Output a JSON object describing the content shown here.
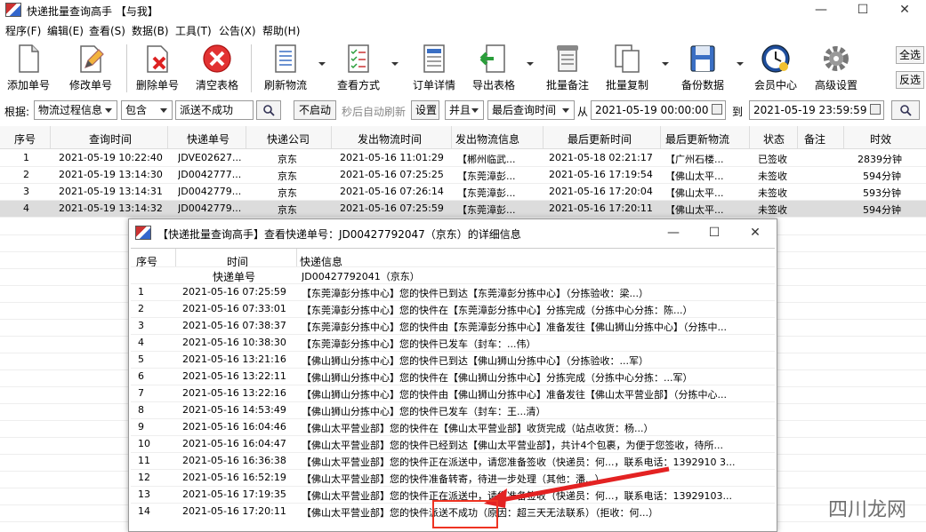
{
  "window": {
    "title": "快递批量查询高手 【与我】"
  },
  "menu": [
    "程序(F)",
    "编辑(E)",
    "查看(S)",
    "数据(B)",
    "工具(T)",
    "公告(X)",
    "帮助(H)"
  ],
  "toolbar": [
    {
      "label": "添加单号",
      "icon": "document-icon"
    },
    {
      "label": "修改单号",
      "icon": "pencil-icon"
    },
    {
      "label": "删除单号",
      "icon": "delete-icon"
    },
    {
      "label": "清空表格",
      "icon": "clear-icon"
    },
    {
      "label": "刷新物流",
      "icon": "refresh-list-icon"
    },
    {
      "label": "查看方式",
      "icon": "checklist-icon"
    },
    {
      "label": "订单详情",
      "icon": "order-detail-icon"
    },
    {
      "label": "导出表格",
      "icon": "export-icon"
    },
    {
      "label": "批量备注",
      "icon": "note-icon"
    },
    {
      "label": "批量复制",
      "icon": "copy-icon"
    },
    {
      "label": "备份数据",
      "icon": "floppy-icon"
    },
    {
      "label": "会员中心",
      "icon": "clock-icon"
    },
    {
      "label": "高级设置",
      "icon": "gear-icon"
    }
  ],
  "side_buttons": [
    "全选",
    "反选"
  ],
  "filter": {
    "label": "根据:",
    "field": "物流过程信息",
    "op": "包含",
    "keyword": "派送不成功",
    "no_start": "不启动",
    "auto_refresh": "秒后自动刷新",
    "settings": "设置",
    "join": "并且",
    "time_field": "最后查询时间",
    "from_label": "从",
    "from": "2021-05-19 00:00:00",
    "to_label": "到",
    "to": "2021-05-19 23:59:59"
  },
  "grid": {
    "headers": [
      "序号",
      "查询时间",
      "快递单号",
      "快递公司",
      "发出物流时间",
      "发出物流信息",
      "最后更新时间",
      "最后更新物流",
      "状态",
      "备注",
      "时效"
    ],
    "rows": [
      [
        "1",
        "2021-05-19 10:22:40",
        "JDVE02627...",
        "京东",
        "2021-05-16 11:01:29",
        "【郴州临武...",
        "2021-05-18 02:21:17",
        "【广州石楼...",
        "已签收",
        "",
        "2839分钟"
      ],
      [
        "2",
        "2021-05-19 13:14:30",
        "JD0042777...",
        "京东",
        "2021-05-16 07:25:25",
        "【东莞漳彭...",
        "2021-05-16 17:19:54",
        "【佛山太平...",
        "未签收",
        "",
        "594分钟"
      ],
      [
        "3",
        "2021-05-19 13:14:31",
        "JD0042779...",
        "京东",
        "2021-05-16 07:26:14",
        "【东莞漳彭...",
        "2021-05-16 17:20:04",
        "【佛山太平...",
        "未签收",
        "",
        "593分钟"
      ],
      [
        "4",
        "2021-05-19 13:14:32",
        "JD0042779...",
        "京东",
        "2021-05-16 07:25:59",
        "【东莞漳彭...",
        "2021-05-16 17:20:11",
        "【佛山太平...",
        "未签收",
        "",
        "594分钟"
      ]
    ]
  },
  "dialog": {
    "title": "【快递批量查询高手】查看快递单号：JD00427792047（京东）的详细信息",
    "headers": [
      "序号",
      "时间",
      "快递信息"
    ],
    "waybill_label": "快递单号",
    "waybill_value": "JD00427792041（京东）",
    "rows": [
      [
        "1",
        "2021-05-16 07:25:59",
        "【东莞漳彭分拣中心】您的快件已到达【东莞漳彭分拣中心】（分拣验收：梁...）"
      ],
      [
        "2",
        "2021-05-16 07:33:01",
        "【东莞漳彭分拣中心】您的快件在【东莞漳彭分拣中心】分拣完成（分拣中心分拣：陈...）"
      ],
      [
        "3",
        "2021-05-16 07:38:37",
        "【东莞漳彭分拣中心】您的快件由【东莞漳彭分拣中心】准备发往【佛山狮山分拣中心】（分拣中..."
      ],
      [
        "4",
        "2021-05-16 10:38:30",
        "【东莞漳彭分拣中心】您的快件已发车（封车：...伟）"
      ],
      [
        "5",
        "2021-05-16 13:21:16",
        "【佛山狮山分拣中心】您的快件已到达【佛山狮山分拣中心】（分拣验收：...军）"
      ],
      [
        "6",
        "2021-05-16 13:22:11",
        "【佛山狮山分拣中心】您的快件在【佛山狮山分拣中心】分拣完成（分拣中心分拣：...军）"
      ],
      [
        "7",
        "2021-05-16 13:22:16",
        "【佛山狮山分拣中心】您的快件由【佛山狮山分拣中心】准备发往【佛山太平营业部】（分拣中心..."
      ],
      [
        "8",
        "2021-05-16 14:53:49",
        "【佛山狮山分拣中心】您的快件已发车（封车：王...清）"
      ],
      [
        "9",
        "2021-05-16 16:04:46",
        "【佛山太平营业部】您的快件在【佛山太平营业部】收货完成（站点收货：杨...）"
      ],
      [
        "10",
        "2021-05-16 16:04:47",
        "【佛山太平营业部】您的快件已经到达【佛山太平营业部】，共计4个包裹，为便于您签收，待所..."
      ],
      [
        "11",
        "2021-05-16 16:36:38",
        "【佛山太平营业部】您的快件正在派送中，请您准备签收（快递员：何...，联系电话：1392910 3..."
      ],
      [
        "12",
        "2021-05-16 16:52:19",
        "【佛山太平营业部】您的快件准备转寄，待进一步处理（其他：潘...）"
      ],
      [
        "13",
        "2021-05-16 17:19:35",
        "【佛山太平营业部】您的快件正在派送中，请您准备签收（快递员：何...，联系电话：13929103..."
      ],
      [
        "14",
        "2021-05-16 17:20:11",
        "【佛山太平营业部】您的快件派送不成功（原因：超三天无法联系）（拒收：何...）"
      ]
    ]
  },
  "watermark": "四川龙网",
  "colors": {
    "annotation": "#e32222",
    "selected_row": "#dcdcdc"
  }
}
